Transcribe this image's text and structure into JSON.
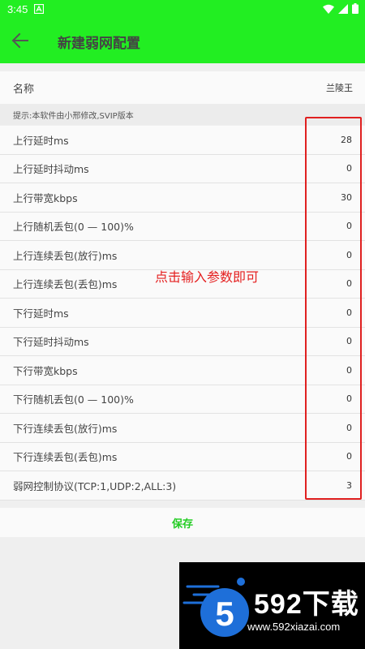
{
  "status_bar": {
    "time": "3:45",
    "icons": [
      "notification-a-icon",
      "wifi-icon",
      "signal-icon",
      "battery-icon"
    ]
  },
  "app_bar": {
    "title": "新建弱网配置",
    "back_icon": "arrow-left-icon",
    "color": "#22ee22"
  },
  "name_row": {
    "label": "名称",
    "value": "兰陵王"
  },
  "hint": "提示:本软件由小邢修改,SVIP版本",
  "params": [
    {
      "label": "上行延时ms",
      "value": "28"
    },
    {
      "label": "上行延时抖动ms",
      "value": "0"
    },
    {
      "label": "上行带宽kbps",
      "value": "30"
    },
    {
      "label": "上行随机丢包(0 — 100)%",
      "value": "0"
    },
    {
      "label": "上行连续丢包(放行)ms",
      "value": "0"
    },
    {
      "label": "上行连续丢包(丢包)ms",
      "value": "0"
    },
    {
      "label": "下行延时ms",
      "value": "0"
    },
    {
      "label": "下行延时抖动ms",
      "value": "0"
    },
    {
      "label": "下行带宽kbps",
      "value": "0"
    },
    {
      "label": "下行随机丢包(0 — 100)%",
      "value": "0"
    },
    {
      "label": "下行连续丢包(放行)ms",
      "value": "0"
    },
    {
      "label": "下行连续丢包(丢包)ms",
      "value": "0"
    },
    {
      "label": "弱网控制协议(TCP:1,UDP:2,ALL:3)",
      "value": "3"
    }
  ],
  "annotation": "点击输入参数即可",
  "save_label": "保存",
  "watermark": {
    "brand": "592下载",
    "url": "www.592xiazai.com",
    "logo_digit": "5"
  },
  "colors": {
    "accent": "#22ee22",
    "save_text": "#22cc22",
    "highlight": "#e02020"
  }
}
